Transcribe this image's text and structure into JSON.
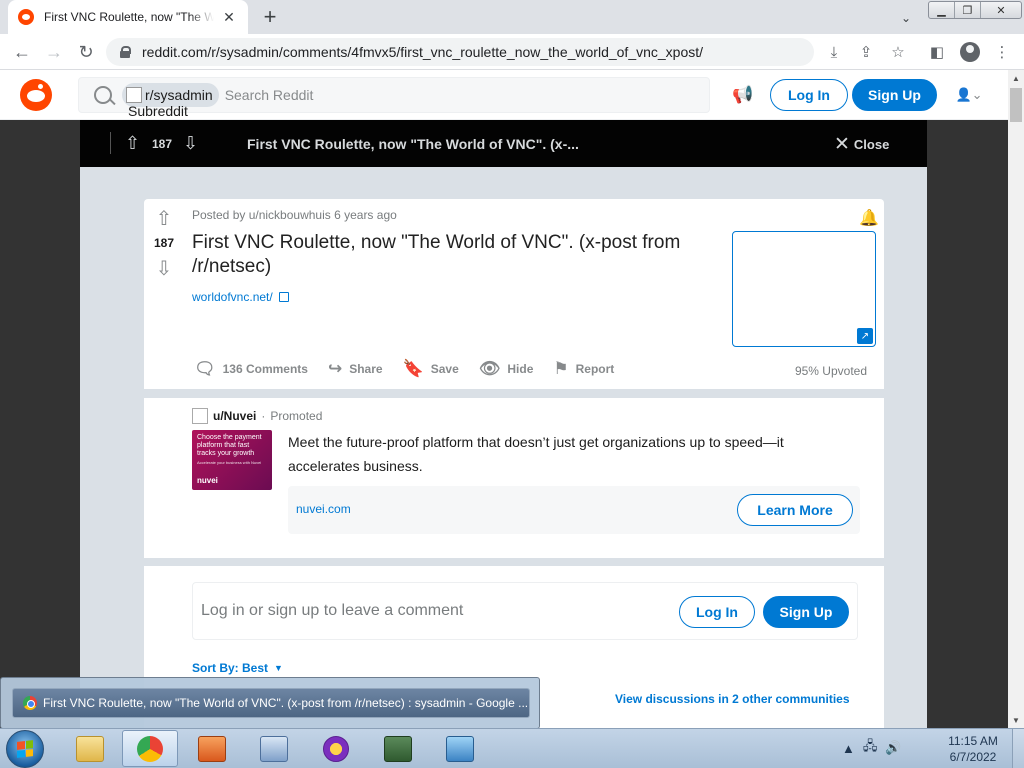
{
  "browser": {
    "tab_title": "First VNC Roulette, now \"The World of VNC\". (x-post from /r/netsec) : sysadmin",
    "url": "reddit.com/r/sysadmin/comments/4fmvx5/first_vnc_roulette_now_the_world_of_vnc_xpost/",
    "new_tab_glyph": "+",
    "tab_close_glyph": "✕"
  },
  "reddit_header": {
    "community_chip": "r/sysadmin",
    "community_chip_alt": "Subreddit",
    "search_placeholder": "Search Reddit",
    "login_label": "Log In",
    "signup_label": "Sign Up"
  },
  "overlay": {
    "score": "187",
    "title_truncated": "First VNC Roulette, now \"The World of VNC\". (x-...",
    "close_label": "Close"
  },
  "post": {
    "meta": "Posted by u/nickbouwhuis 6 years ago",
    "score": "187",
    "title": "First VNC Roulette, now \"The World of VNC\". (x-post from /r/netsec)",
    "domain": "worldofvnc.net/",
    "actions": {
      "comments": "136 Comments",
      "share": "Share",
      "save": "Save",
      "hide": "Hide",
      "report": "Report"
    },
    "upvoted": "95% Upvoted"
  },
  "ad": {
    "advertiser": "u/Nuvei",
    "separator": "·",
    "promoted": "Promoted",
    "creative_headline": "Choose the payment platform that fast tracks your growth",
    "creative_sub": "Accelerate your business with Nuvei",
    "creative_brand": "nuvei",
    "text": "Meet the future-proof platform that doesn’t just get organizations up to speed—it accelerates business.",
    "domain": "nuvei.com",
    "cta": "Learn More"
  },
  "comments": {
    "prompt": "Log in or sign up to leave a comment",
    "login_label": "Log In",
    "signup_label": "Sign Up",
    "sort_label": "Sort By: Best",
    "view_discussions": "View discussions in 2 other communities"
  },
  "taskbar": {
    "preview_title": "First VNC Roulette, now \"The World of VNC\". (x-post from /r/netsec) : sysadmin - Google ...",
    "time": "11:15 AM",
    "date": "6/7/2022"
  },
  "colors": {
    "reddit_orange": "#ff4500",
    "reddit_blue": "#0079d3",
    "overlay_dark": "#030303",
    "page_bg": "#dae0e6"
  }
}
